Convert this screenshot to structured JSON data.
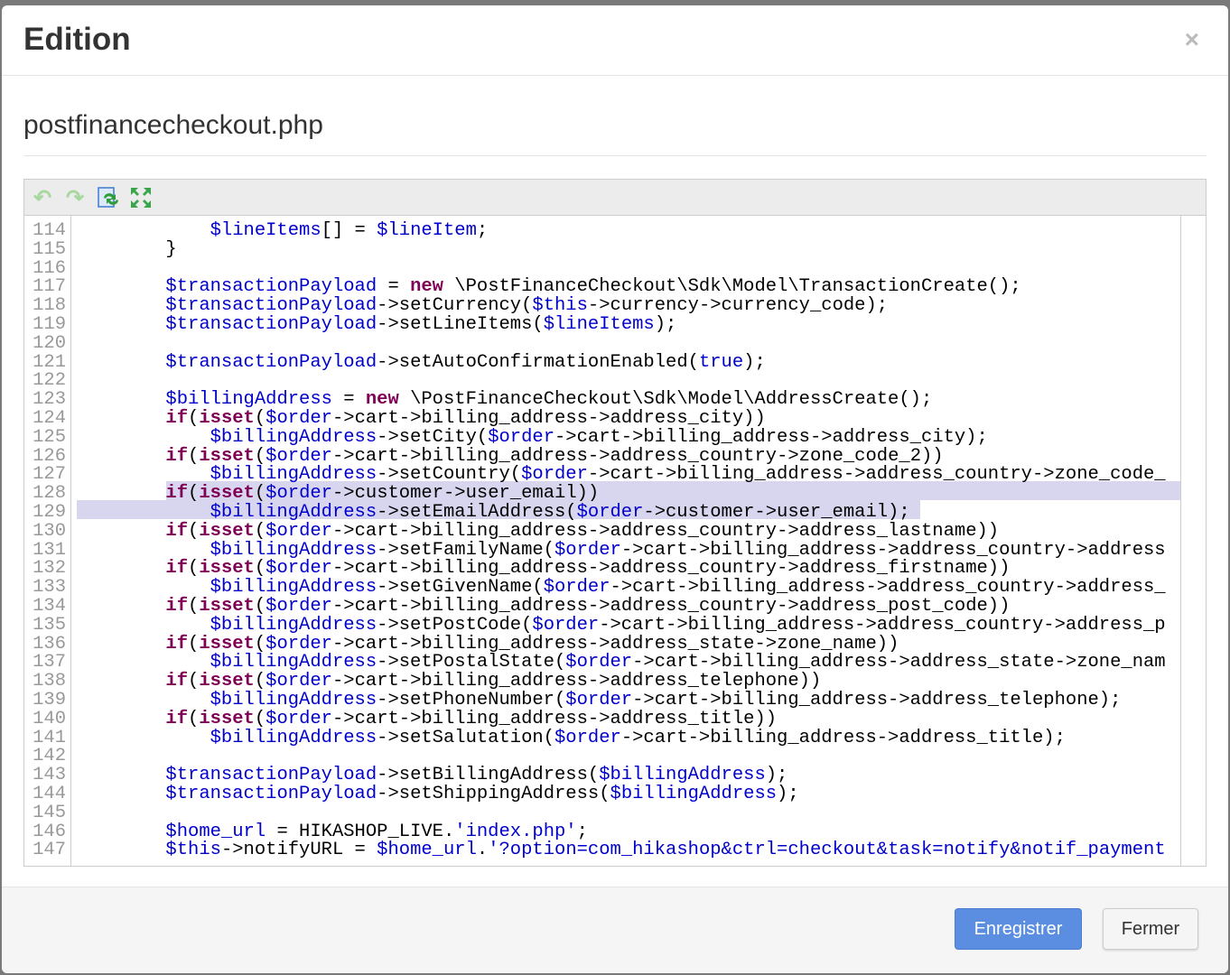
{
  "modal": {
    "title": "Edition",
    "close_icon": "×"
  },
  "file": {
    "name": "postfinancecheckout.php"
  },
  "toolbar": {
    "undo": "undo-icon",
    "redo": "redo-icon",
    "reload": "reload-icon",
    "fullscreen": "fullscreen-icon"
  },
  "code": {
    "lines": [
      {
        "n": "114",
        "t": [
          [
            "p",
            "            "
          ],
          [
            "v",
            "$lineItems"
          ],
          [
            "p",
            "[] = "
          ],
          [
            "v",
            "$lineItem"
          ],
          [
            "p",
            ";"
          ]
        ]
      },
      {
        "n": "115",
        "t": [
          [
            "p",
            "        }"
          ]
        ]
      },
      {
        "n": "116",
        "t": []
      },
      {
        "n": "117",
        "t": [
          [
            "p",
            "        "
          ],
          [
            "v",
            "$transactionPayload"
          ],
          [
            "p",
            " = "
          ],
          [
            "k",
            "new"
          ],
          [
            "p",
            " \\PostFinanceCheckout\\Sdk\\Model\\TransactionCreate();"
          ]
        ]
      },
      {
        "n": "118",
        "t": [
          [
            "p",
            "        "
          ],
          [
            "v",
            "$transactionPayload"
          ],
          [
            "p",
            "->setCurrency("
          ],
          [
            "v",
            "$this"
          ],
          [
            "p",
            "->currency->currency_code);"
          ]
        ]
      },
      {
        "n": "119",
        "t": [
          [
            "p",
            "        "
          ],
          [
            "v",
            "$transactionPayload"
          ],
          [
            "p",
            "->setLineItems("
          ],
          [
            "v",
            "$lineItems"
          ],
          [
            "p",
            ");"
          ]
        ]
      },
      {
        "n": "120",
        "t": []
      },
      {
        "n": "121",
        "t": [
          [
            "p",
            "        "
          ],
          [
            "v",
            "$transactionPayload"
          ],
          [
            "p",
            "->setAutoConfirmationEnabled("
          ],
          [
            "v",
            "true"
          ],
          [
            "p",
            ");"
          ]
        ]
      },
      {
        "n": "122",
        "t": []
      },
      {
        "n": "123",
        "t": [
          [
            "p",
            "        "
          ],
          [
            "v",
            "$billingAddress"
          ],
          [
            "p",
            " = "
          ],
          [
            "k",
            "new"
          ],
          [
            "p",
            " \\PostFinanceCheckout\\Sdk\\Model\\AddressCreate();"
          ]
        ]
      },
      {
        "n": "124",
        "t": [
          [
            "p",
            "        "
          ],
          [
            "k",
            "if"
          ],
          [
            "p",
            "("
          ],
          [
            "k",
            "isset"
          ],
          [
            "p",
            "("
          ],
          [
            "v",
            "$order"
          ],
          [
            "p",
            "->cart->billing_address->address_city))"
          ]
        ]
      },
      {
        "n": "125",
        "t": [
          [
            "p",
            "            "
          ],
          [
            "v",
            "$billingAddress"
          ],
          [
            "p",
            "->setCity("
          ],
          [
            "v",
            "$order"
          ],
          [
            "p",
            "->cart->billing_address->address_city);"
          ]
        ]
      },
      {
        "n": "126",
        "t": [
          [
            "p",
            "        "
          ],
          [
            "k",
            "if"
          ],
          [
            "p",
            "("
          ],
          [
            "k",
            "isset"
          ],
          [
            "p",
            "("
          ],
          [
            "v",
            "$order"
          ],
          [
            "p",
            "->cart->billing_address->address_country->zone_code_2))"
          ]
        ]
      },
      {
        "n": "127",
        "t": [
          [
            "p",
            "            "
          ],
          [
            "v",
            "$billingAddress"
          ],
          [
            "p",
            "->setCountry("
          ],
          [
            "v",
            "$order"
          ],
          [
            "p",
            "->cart->billing_address->address_country->zone_code_"
          ]
        ]
      },
      {
        "n": "128",
        "t": [
          [
            "p",
            "        "
          ],
          [
            "k",
            "if"
          ],
          [
            "p",
            "("
          ],
          [
            "k",
            "isset"
          ],
          [
            "p",
            "("
          ],
          [
            "v",
            "$order"
          ],
          [
            "p",
            "->customer->user_email))"
          ]
        ]
      },
      {
        "n": "129",
        "t": [
          [
            "p",
            "            "
          ],
          [
            "v",
            "$billingAddress"
          ],
          [
            "p",
            "->setEmailAddress("
          ],
          [
            "v",
            "$order"
          ],
          [
            "p",
            "->customer->user_email);"
          ]
        ]
      },
      {
        "n": "130",
        "t": [
          [
            "p",
            "        "
          ],
          [
            "k",
            "if"
          ],
          [
            "p",
            "("
          ],
          [
            "k",
            "isset"
          ],
          [
            "p",
            "("
          ],
          [
            "v",
            "$order"
          ],
          [
            "p",
            "->cart->billing_address->address_country->address_lastname))"
          ]
        ]
      },
      {
        "n": "131",
        "t": [
          [
            "p",
            "            "
          ],
          [
            "v",
            "$billingAddress"
          ],
          [
            "p",
            "->setFamilyName("
          ],
          [
            "v",
            "$order"
          ],
          [
            "p",
            "->cart->billing_address->address_country->address"
          ]
        ]
      },
      {
        "n": "132",
        "t": [
          [
            "p",
            "        "
          ],
          [
            "k",
            "if"
          ],
          [
            "p",
            "("
          ],
          [
            "k",
            "isset"
          ],
          [
            "p",
            "("
          ],
          [
            "v",
            "$order"
          ],
          [
            "p",
            "->cart->billing_address->address_country->address_firstname))"
          ]
        ]
      },
      {
        "n": "133",
        "t": [
          [
            "p",
            "            "
          ],
          [
            "v",
            "$billingAddress"
          ],
          [
            "p",
            "->setGivenName("
          ],
          [
            "v",
            "$order"
          ],
          [
            "p",
            "->cart->billing_address->address_country->address_"
          ]
        ]
      },
      {
        "n": "134",
        "t": [
          [
            "p",
            "        "
          ],
          [
            "k",
            "if"
          ],
          [
            "p",
            "("
          ],
          [
            "k",
            "isset"
          ],
          [
            "p",
            "("
          ],
          [
            "v",
            "$order"
          ],
          [
            "p",
            "->cart->billing_address->address_country->address_post_code))"
          ]
        ]
      },
      {
        "n": "135",
        "t": [
          [
            "p",
            "            "
          ],
          [
            "v",
            "$billingAddress"
          ],
          [
            "p",
            "->setPostCode("
          ],
          [
            "v",
            "$order"
          ],
          [
            "p",
            "->cart->billing_address->address_country->address_p"
          ]
        ]
      },
      {
        "n": "136",
        "t": [
          [
            "p",
            "        "
          ],
          [
            "k",
            "if"
          ],
          [
            "p",
            "("
          ],
          [
            "k",
            "isset"
          ],
          [
            "p",
            "("
          ],
          [
            "v",
            "$order"
          ],
          [
            "p",
            "->cart->billing_address->address_state->zone_name))"
          ]
        ]
      },
      {
        "n": "137",
        "t": [
          [
            "p",
            "            "
          ],
          [
            "v",
            "$billingAddress"
          ],
          [
            "p",
            "->setPostalState("
          ],
          [
            "v",
            "$order"
          ],
          [
            "p",
            "->cart->billing_address->address_state->zone_nam"
          ]
        ]
      },
      {
        "n": "138",
        "t": [
          [
            "p",
            "        "
          ],
          [
            "k",
            "if"
          ],
          [
            "p",
            "("
          ],
          [
            "k",
            "isset"
          ],
          [
            "p",
            "("
          ],
          [
            "v",
            "$order"
          ],
          [
            "p",
            "->cart->billing_address->address_telephone))"
          ]
        ]
      },
      {
        "n": "139",
        "t": [
          [
            "p",
            "            "
          ],
          [
            "v",
            "$billingAddress"
          ],
          [
            "p",
            "->setPhoneNumber("
          ],
          [
            "v",
            "$order"
          ],
          [
            "p",
            "->cart->billing_address->address_telephone);"
          ]
        ]
      },
      {
        "n": "140",
        "t": [
          [
            "p",
            "        "
          ],
          [
            "k",
            "if"
          ],
          [
            "p",
            "("
          ],
          [
            "k",
            "isset"
          ],
          [
            "p",
            "("
          ],
          [
            "v",
            "$order"
          ],
          [
            "p",
            "->cart->billing_address->address_title))"
          ]
        ]
      },
      {
        "n": "141",
        "t": [
          [
            "p",
            "            "
          ],
          [
            "v",
            "$billingAddress"
          ],
          [
            "p",
            "->setSalutation("
          ],
          [
            "v",
            "$order"
          ],
          [
            "p",
            "->cart->billing_address->address_title);"
          ]
        ]
      },
      {
        "n": "142",
        "t": []
      },
      {
        "n": "143",
        "t": [
          [
            "p",
            "        "
          ],
          [
            "v",
            "$transactionPayload"
          ],
          [
            "p",
            "->setBillingAddress("
          ],
          [
            "v",
            "$billingAddress"
          ],
          [
            "p",
            ");"
          ]
        ]
      },
      {
        "n": "144",
        "t": [
          [
            "p",
            "        "
          ],
          [
            "v",
            "$transactionPayload"
          ],
          [
            "p",
            "->setShippingAddress("
          ],
          [
            "v",
            "$billingAddress"
          ],
          [
            "p",
            ");"
          ]
        ]
      },
      {
        "n": "145",
        "t": []
      },
      {
        "n": "146",
        "t": [
          [
            "p",
            "        "
          ],
          [
            "v",
            "$home_url"
          ],
          [
            "p",
            " = HIKASHOP_LIVE."
          ],
          [
            "s",
            "'index.php'"
          ],
          [
            "p",
            ";"
          ]
        ]
      },
      {
        "n": "147",
        "t": [
          [
            "p",
            "        "
          ],
          [
            "v",
            "$this"
          ],
          [
            "p",
            "->notifyURL = "
          ],
          [
            "v",
            "$home_url"
          ],
          [
            "p",
            "."
          ],
          [
            "s",
            "'?option=com_hikashop&ctrl=checkout&task=notify&notif_payment"
          ]
        ]
      }
    ]
  },
  "footer": {
    "save_label": "Enregistrer",
    "close_label": "Fermer"
  },
  "colors": {
    "accent": "#5b8ee0",
    "variable": "#0000cc",
    "keyword": "#7f0055",
    "selection": "#d8d6ee"
  }
}
